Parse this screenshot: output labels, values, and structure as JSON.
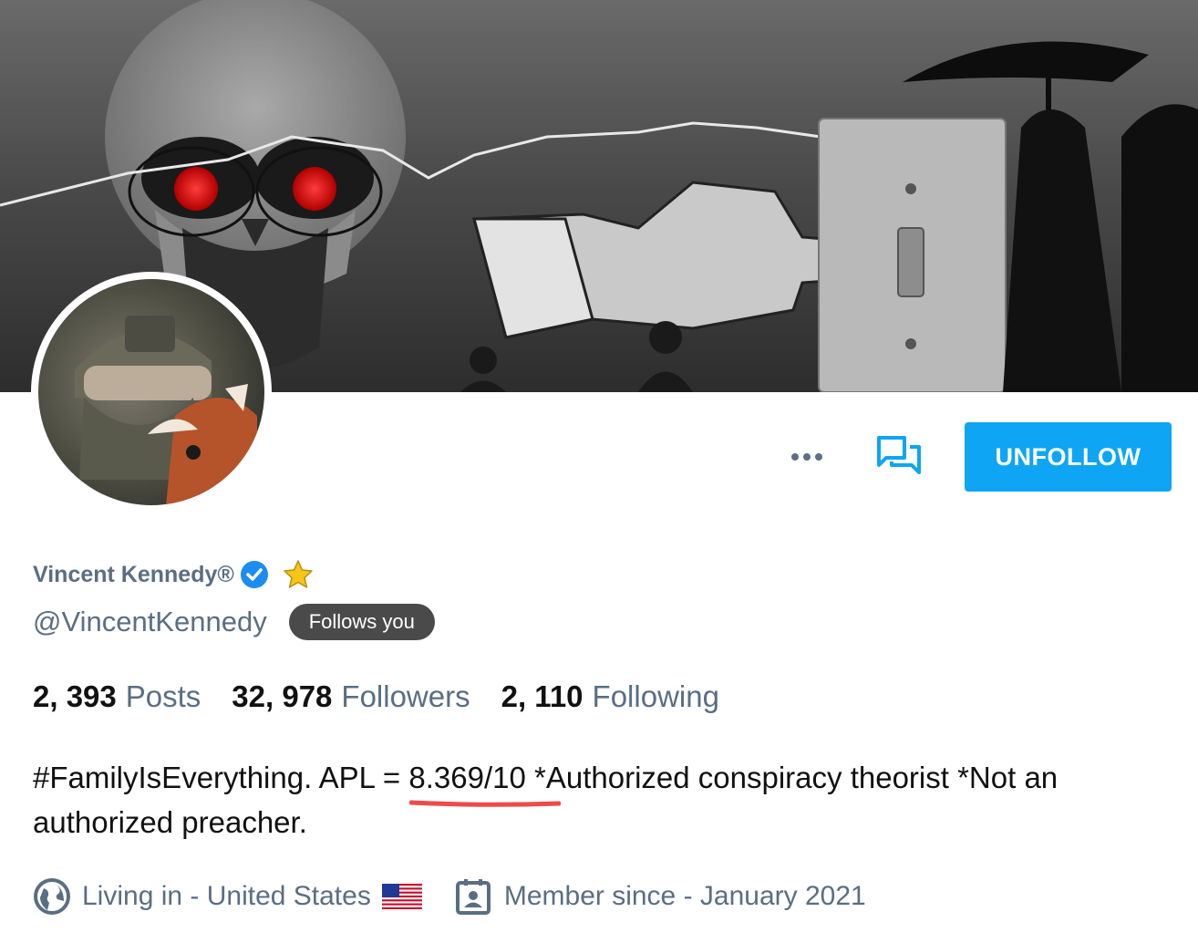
{
  "profile": {
    "display_name": "Vincent Kennedy®",
    "handle": "@VincentKennedy",
    "follows_badge": "Follows you",
    "bio_part1": "#FamilyIsEverything. APL = ",
    "bio_highlight": "8.369/10",
    "bio_part2": " *Authorized conspiracy theorist *Not an authorized preacher.",
    "location_text": "Living in - United States",
    "member_since_text": "Member since - January 2021"
  },
  "stats": {
    "posts_count": "2, 393",
    "posts_label": "Posts",
    "followers_count": "32, 978",
    "followers_label": "Followers",
    "following_count": "2, 110",
    "following_label": "Following"
  },
  "actions": {
    "unfollow_label": "UNFOLLOW"
  },
  "icons": {
    "more": "more-dots-icon",
    "message": "chat-bubbles-icon",
    "verified": "verified-check-icon",
    "star": "star-icon",
    "globe": "globe-icon",
    "flag": "us-flag-icon",
    "calendar": "member-badge-icon"
  },
  "colors": {
    "accent": "#0ea5f4",
    "secondary_text": "#5a6e83",
    "badge_bg": "#4a4a4a",
    "highlight_underline": "#ee4a4a",
    "star": "#f5c518"
  }
}
